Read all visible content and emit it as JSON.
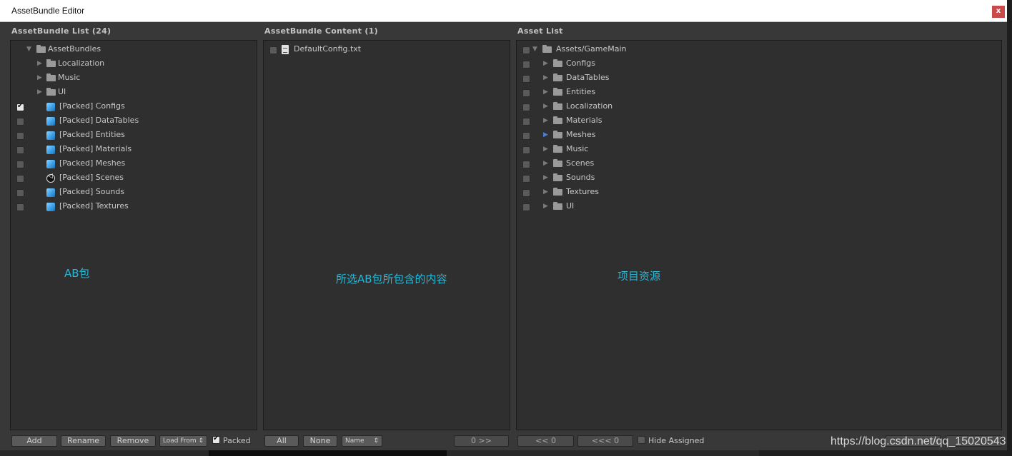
{
  "window": {
    "title": "AssetBundle Editor",
    "close_label": "x"
  },
  "bundle_list": {
    "header": "AssetBundle List (24)",
    "items": [
      {
        "label": "AssetBundles"
      },
      {
        "label": "Localization"
      },
      {
        "label": "Music"
      },
      {
        "label": "UI"
      },
      {
        "label": "[Packed] Configs",
        "checked": true
      },
      {
        "label": "[Packed] DataTables"
      },
      {
        "label": "[Packed] Entities"
      },
      {
        "label": "[Packed] Materials"
      },
      {
        "label": "[Packed] Meshes"
      },
      {
        "label": "[Packed] Scenes"
      },
      {
        "label": "[Packed] Sounds"
      },
      {
        "label": "[Packed] Textures"
      }
    ],
    "annotation": "AB包",
    "buttons": {
      "add": "Add",
      "rename": "Rename",
      "remove": "Remove",
      "load_from": "Load From",
      "packed": "Packed"
    }
  },
  "bundle_content": {
    "header": "AssetBundle Content (1)",
    "items": [
      {
        "label": "DefaultConfig.txt"
      }
    ],
    "annotation": "所选AB包所包含的内容",
    "buttons": {
      "all": "All",
      "none": "None",
      "sort": "Name",
      "move_right": "0 >>"
    }
  },
  "asset_list": {
    "header": "Asset List",
    "items": [
      {
        "label": "Assets/GameMain"
      },
      {
        "label": "Configs"
      },
      {
        "label": "DataTables"
      },
      {
        "label": "Entities"
      },
      {
        "label": "Localization"
      },
      {
        "label": "Materials"
      },
      {
        "label": "Meshes",
        "highlighted": true
      },
      {
        "label": "Music"
      },
      {
        "label": "Scenes"
      },
      {
        "label": "Sounds"
      },
      {
        "label": "Textures"
      },
      {
        "label": "UI"
      }
    ],
    "annotation": "项目资源",
    "buttons": {
      "move_left": "<< 0",
      "move_left_all": "<<< 0",
      "hide_assigned": "Hide Assigned"
    }
  },
  "watermark": "https://blog.csdn.net/qq_15020543",
  "colors": {
    "annotation": "#29b7d6",
    "close": "#c94a4a",
    "panel": "#2f2f2f",
    "background": "#383838"
  }
}
